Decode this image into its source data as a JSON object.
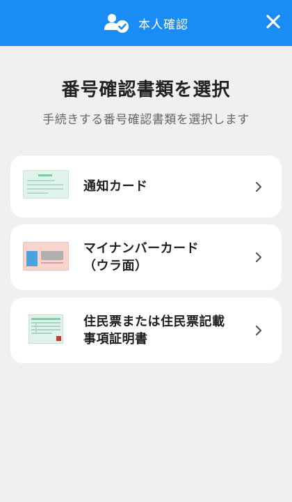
{
  "header": {
    "title": "本人確認",
    "icon": "user-check-icon",
    "close_icon": "close-icon",
    "bg_color": "#1a8cf5"
  },
  "main": {
    "title": "番号確認書類を選択",
    "subtitle": "手続きする番号確認書類を選択します"
  },
  "options": [
    {
      "label_line1": "通知カード",
      "label_line2": "",
      "icon": "notification-card-icon"
    },
    {
      "label_line1": "マイナンバーカード",
      "label_line2": "（ウラ面）",
      "icon": "mynumber-card-back-icon"
    },
    {
      "label_line1": "住民票または住民票記載",
      "label_line2": "事項証明書",
      "icon": "residence-certificate-icon"
    }
  ]
}
